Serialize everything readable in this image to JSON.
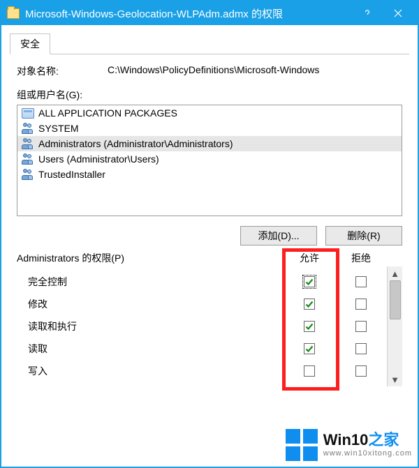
{
  "window": {
    "title": "Microsoft-Windows-Geolocation-WLPAdm.admx 的权限"
  },
  "tab": {
    "label": "安全"
  },
  "object_name": {
    "label": "对象名称:",
    "value": "C:\\Windows\\PolicyDefinitions\\Microsoft-Windows"
  },
  "groups": {
    "label": "组或用户名(G):",
    "items": [
      {
        "icon": "pkg",
        "text": "ALL APPLICATION PACKAGES"
      },
      {
        "icon": "users",
        "text": "SYSTEM"
      },
      {
        "icon": "users",
        "text": "Administrators (Administrator\\Administrators)",
        "selected": true
      },
      {
        "icon": "users",
        "text": "Users (Administrator\\Users)"
      },
      {
        "icon": "users",
        "text": "TrustedInstaller"
      }
    ]
  },
  "buttons": {
    "add": "添加(D)...",
    "remove": "删除(R)"
  },
  "perm_header": {
    "title": "Administrators 的权限(P)",
    "allow": "允许",
    "deny": "拒绝"
  },
  "permissions": [
    {
      "name": "完全控制",
      "allow": true,
      "deny": false,
      "focus": true
    },
    {
      "name": "修改",
      "allow": true,
      "deny": false
    },
    {
      "name": "读取和执行",
      "allow": true,
      "deny": false
    },
    {
      "name": "读取",
      "allow": true,
      "deny": false
    },
    {
      "name": "写入",
      "allow": false,
      "deny": false
    }
  ],
  "watermark": {
    "brand_main": "Win10",
    "brand_suffix": "之家",
    "url": "www.win10xitong.com"
  }
}
